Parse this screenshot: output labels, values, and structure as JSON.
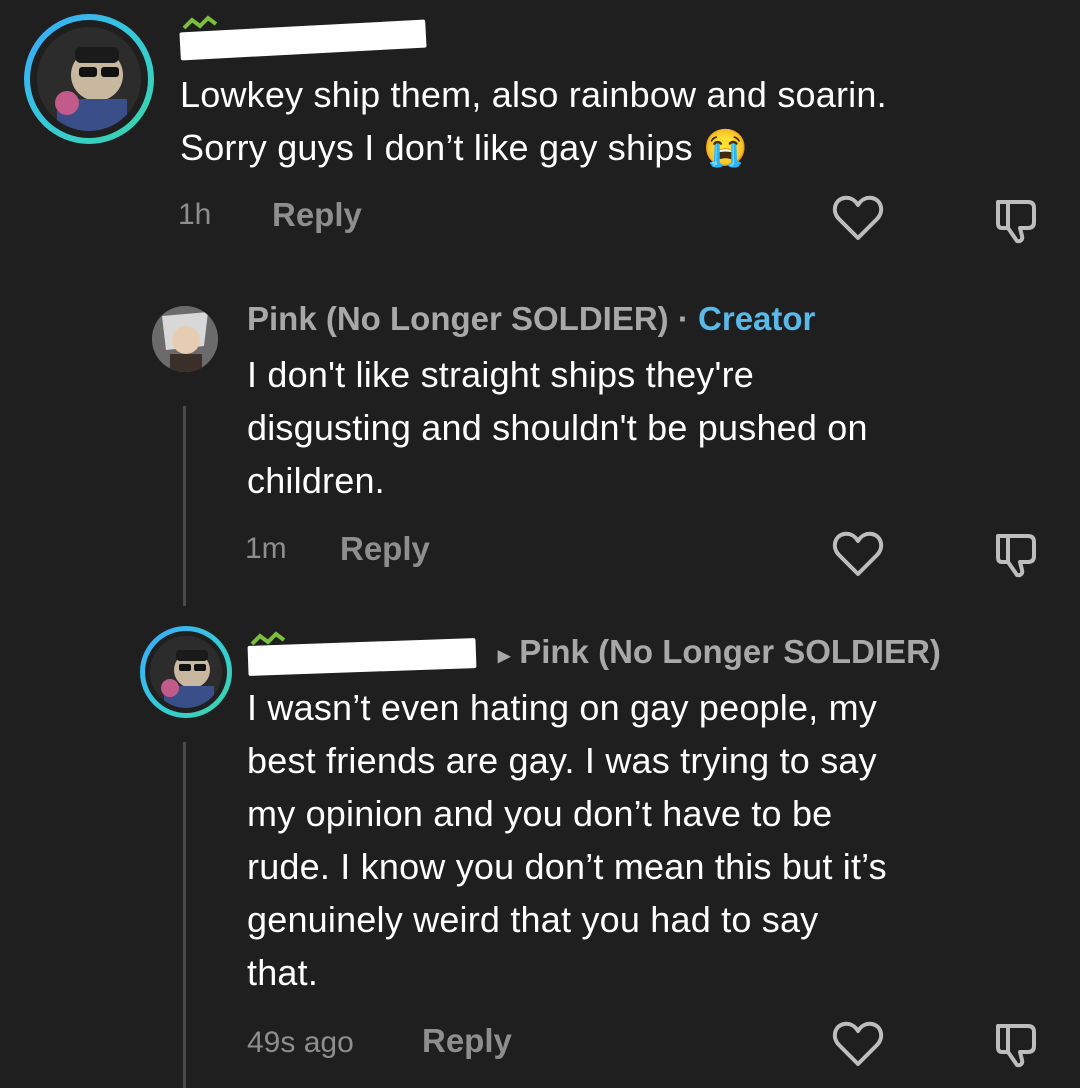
{
  "comments": [
    {
      "text_lines": [
        "Lowkey ship them, also rainbow and soarin.",
        "Sorry guys I don’t like gay ships 😭"
      ],
      "time": "1h",
      "reply_label": "Reply"
    },
    {
      "author": "Pink (No Longer SOLDIER)",
      "separator": "·",
      "badge": "Creator",
      "text_lines": [
        "I don't like straight ships they're",
        "disgusting and shouldn't be pushed on",
        "children."
      ],
      "time": "1m",
      "reply_label": "Reply"
    },
    {
      "reply_to_arrow": "▸",
      "reply_to": "Pink (No Longer SOLDIER)",
      "text_lines": [
        "I wasn’t even hating on gay people, my",
        "best friends are gay. I was trying to say",
        "my opinion and you don’t have to be",
        "rude. I know you don’t mean this but it’s",
        "genuinely weird that you had to say",
        "that."
      ],
      "time": "49s ago",
      "reply_label": "Reply"
    }
  ],
  "icons": {
    "like": "heart-icon",
    "dislike": "thumbs-down-icon"
  },
  "colors": {
    "background": "#1f1f1f",
    "text": "#ffffff",
    "muted": "#8e8e8e",
    "creator": "#5ab9e8",
    "ring_start": "#3aa7ff",
    "ring_end": "#3ad6a6"
  }
}
